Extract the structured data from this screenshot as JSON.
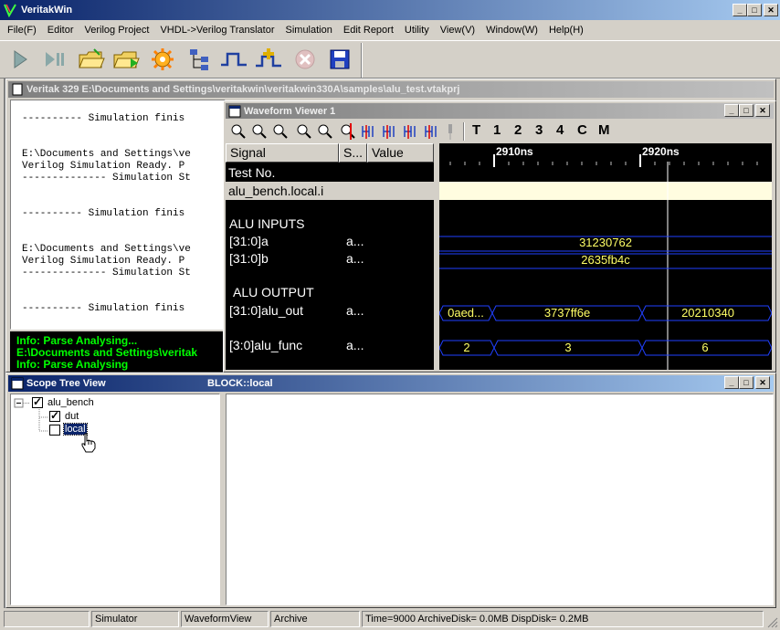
{
  "app": {
    "title": "VeritakWin"
  },
  "menu": [
    "File(F)",
    "Editor",
    "Verilog Project",
    "VHDL->Verilog Translator",
    "Simulation",
    "Edit Report",
    "Utility",
    "View(V)",
    "Window(W)",
    "Help(H)"
  ],
  "project_window": {
    "title": "Veritak 329 E:\\Documents and Settings\\veritakwin\\veritakwin330A\\samples\\alu_test.vtakprj"
  },
  "console": {
    "lines": [
      "---------- Simulation finis",
      "",
      "",
      "E:\\Documents and Settings\\ve",
      "Verilog Simulation Ready. P",
      "-------------- Simulation St",
      "",
      "",
      "---------- Simulation finis",
      "",
      "",
      "E:\\Documents and Settings\\ve",
      "Verilog Simulation Ready. P",
      "-------------- Simulation St",
      "",
      "",
      "---------- Simulation finis"
    ]
  },
  "info_pane": {
    "lines": [
      "Info: Parse Analysing...",
      "E:\\Documents and Settings\\veritak",
      "Info: Parse Analysing"
    ]
  },
  "waveform": {
    "title": "Waveform Viewer 1",
    "tool_labels": [
      "T",
      "1",
      "2",
      "3",
      "4",
      "C",
      "M"
    ],
    "headers": {
      "signal": "Signal",
      "s": "S...",
      "value": "Value"
    },
    "rows": [
      {
        "name": "Test No.",
        "s": ""
      },
      {
        "name": "alu_bench.local.i",
        "s": ""
      },
      {
        "name": "ALU INPUTS",
        "s": ""
      },
      {
        "name": "[31:0]a",
        "s": "a..."
      },
      {
        "name": "[31:0]b",
        "s": "a..."
      },
      {
        "name": "ALU OUTPUT",
        "s": ""
      },
      {
        "name": "[31:0]alu_out",
        "s": "a..."
      },
      {
        "name": "[3:0]alu_func",
        "s": "a..."
      }
    ],
    "time_marks": [
      "2910ns",
      "2920ns"
    ],
    "values": {
      "a": "31230762",
      "b": "2635fb4c",
      "alu_out": [
        "0aed...",
        "3737ff6e",
        "20210340"
      ],
      "alu_func": [
        "2",
        "3",
        "6"
      ]
    }
  },
  "scope_tree": {
    "title": "Scope Tree View",
    "block_label": "BLOCK::local",
    "items": [
      {
        "label": "alu_bench",
        "checked": true
      },
      {
        "label": "dut",
        "checked": true
      },
      {
        "label": "local",
        "checked": false
      }
    ]
  },
  "statusbar": [
    "",
    "Simulator",
    "WaveformView",
    "Archive",
    "Time=9000 ArchiveDisk= 0.0MB DispDisk= 0.2MB"
  ],
  "colors": {
    "title_active": "#0a246a",
    "info_text": "#00ff00",
    "wave_line": "#2040ff",
    "wave_text": "#ffff66",
    "selected_row": "#fffde0"
  }
}
